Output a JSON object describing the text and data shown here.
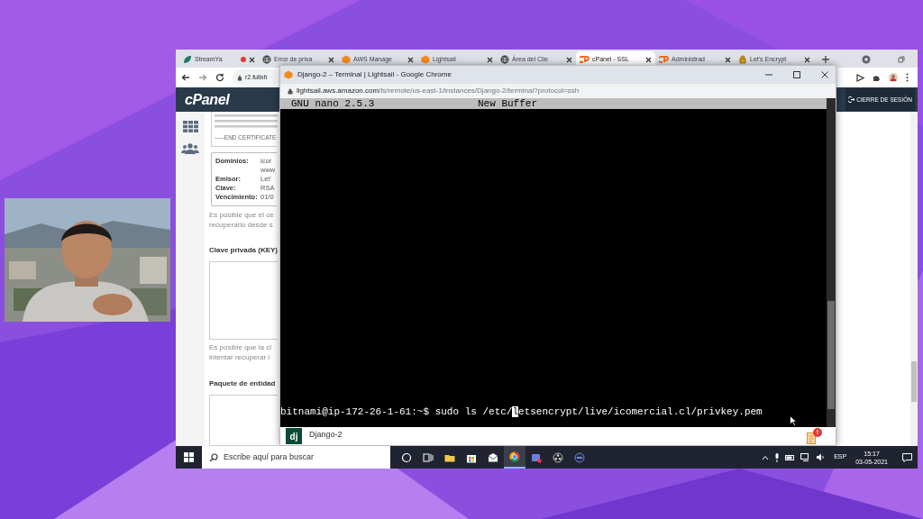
{
  "browser": {
    "tabs": [
      {
        "label": "StreamYa",
        "kind": "streamyard",
        "recording": true,
        "selected": false
      },
      {
        "label": "Error de priva",
        "kind": "globe",
        "recording": false,
        "selected": false
      },
      {
        "label": "AWS Manage",
        "kind": "aws",
        "recording": false,
        "selected": false
      },
      {
        "label": "Lightsail",
        "kind": "aws",
        "recording": false,
        "selected": false
      },
      {
        "label": "Área del Clie",
        "kind": "globe",
        "recording": false,
        "selected": false
      },
      {
        "label": "cPanel - SSL",
        "kind": "cpanel",
        "recording": false,
        "selected": true
      },
      {
        "label": "Administrad",
        "kind": "cpanel",
        "recording": false,
        "selected": false
      },
      {
        "label": "Let's Encrypt",
        "kind": "lock",
        "recording": false,
        "selected": false
      }
    ],
    "address": "r2.fullxh"
  },
  "cpanel": {
    "logo": "cPanel",
    "logout_button": "CIERRE DE SESIÓN",
    "certificate_end": "-----END CERTIFICATE",
    "details": [
      {
        "label": "Dominios:",
        "values": [
          "icor",
          "www"
        ]
      },
      {
        "label": "Emisor:",
        "values": [
          "Let'"
        ]
      },
      {
        "label": "Clave:",
        "values": [
          "RSA"
        ]
      },
      {
        "label": "Vencimiento:",
        "values": [
          "01/0"
        ]
      }
    ],
    "certificate_note": [
      "Es posible que el ce",
      "recuperarlo desde s"
    ],
    "private_key_label": "Clave privada (KEY)",
    "private_key_note": [
      "Es posible que la cl",
      "intentar recuperar l"
    ],
    "bundle_label": "Paquete de entidad"
  },
  "terminal_window": {
    "title": "Django-2 – Terminal | Lightsail - Google Chrome",
    "url_host": "lightsail.aws.amazon.com",
    "url_path": "/ls/remote/us-east-1/instances/Django-2/terminal?protocol=ssh",
    "nano_version": "GNU nano 2.5.3",
    "buffer": "New Buffer",
    "command": {
      "before_cursor": "bitnami@ip-172-26-1-61:~$ sudo ls /etc/",
      "at_cursor": "l",
      "after_cursor": "etsencrypt/live/icomercial.cl/privkey.pem"
    },
    "instance": {
      "icon_text": "dj",
      "name": "Django-2"
    },
    "notification_badge": "!"
  },
  "taskbar": {
    "search_placeholder": "Escribe aquí para buscar",
    "language": "ESP",
    "time": "15:17",
    "date": "03-05-2021"
  }
}
